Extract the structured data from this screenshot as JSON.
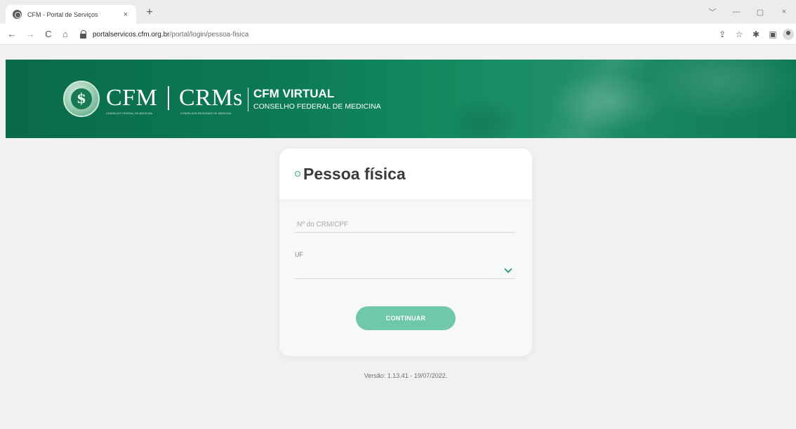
{
  "browser": {
    "tab_title": "CFM - Portal de Serviços",
    "tab_close": "×",
    "new_tab": "+",
    "url_host": "portalservicos.cfm.org.br",
    "url_path": "/portal/login/pessoa-fisica",
    "nav": {
      "back": "←",
      "forward": "→",
      "reload": "C",
      "home": "⌂"
    },
    "window_controls": {
      "dropdown": "﹀",
      "minimize": "—",
      "restore": "▢",
      "close": "×"
    },
    "toolbar": {
      "share": "⇪",
      "bookmark": "☆",
      "extensions": "✱",
      "sidepanel": "▣"
    }
  },
  "banner": {
    "brand_left": "CFM",
    "brand_left_sub": "CONSELHO FEDERAL DE MEDICINA",
    "brand_right": "CRMs",
    "brand_right_sub": "CONSELHOS REGIONAIS DE MEDICINA",
    "title": "CFM VIRTUAL",
    "subtitle": "CONSELHO FEDERAL DE MEDICINA"
  },
  "login": {
    "title": "Pessoa física",
    "crm_placeholder": "Nº do CRM/CPF",
    "uf_label": "UF",
    "continue_label": "CONTINUAR"
  },
  "footer": {
    "version": "Versão: 1.13.41 - 19/07/2022."
  },
  "colors": {
    "brand_green": "#0c7a54",
    "accent": "#2fa07f",
    "button": "#6fc8ab"
  }
}
